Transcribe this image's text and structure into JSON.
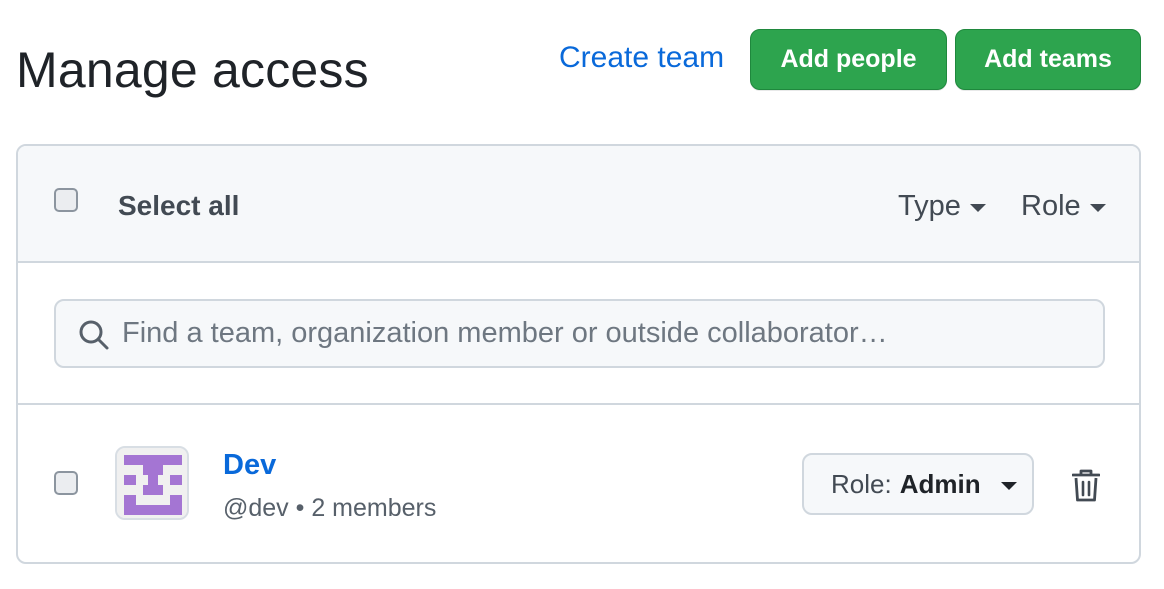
{
  "header": {
    "title": "Manage access",
    "create_team_label": "Create team",
    "add_people_label": "Add people",
    "add_teams_label": "Add teams"
  },
  "list_header": {
    "select_all_label": "Select all",
    "filters": {
      "type_label": "Type",
      "role_label": "Role"
    }
  },
  "search": {
    "placeholder": "Find a team, organization member or outside collaborator…",
    "value": ""
  },
  "teams": [
    {
      "name": "Dev",
      "meta": "@dev • 2 members",
      "role_prefix": "Role:",
      "role_value": "Admin"
    }
  ],
  "colors": {
    "link": "#0969da",
    "primary_button": "#2da44e",
    "avatar_purple": "#a475d3"
  },
  "icons": {
    "search": "search-icon",
    "caret": "caret-down-icon",
    "trash": "trash-icon"
  }
}
